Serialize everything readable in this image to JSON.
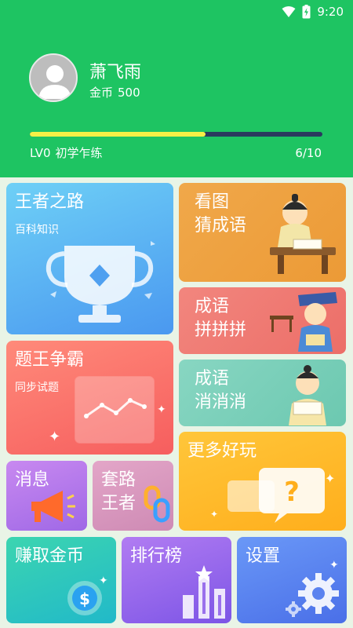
{
  "status_bar": {
    "time": "9:20",
    "icons": [
      "wifi-icon",
      "battery-charging-icon"
    ]
  },
  "profile": {
    "name": "萧飞雨",
    "coins_label": "金币",
    "coins_value": "500",
    "level": "LV0",
    "level_title": "初学乍练",
    "progress_text": "6/10",
    "progress_fraction": 0.6
  },
  "cards": {
    "wangzhe": {
      "title": "王者之路",
      "subtitle": "百科知识"
    },
    "kantu": {
      "title_line1": "看图",
      "title_line2": "猜成语"
    },
    "pinpin": {
      "title_line1": "成语",
      "title_line2": "拼拼拼"
    },
    "xiaoxiao": {
      "title_line1": "成语",
      "title_line2": "消消消"
    },
    "tiwang": {
      "title": "题王争霸",
      "subtitle": "同步试题"
    },
    "more": {
      "title": "更多好玩"
    },
    "message": {
      "title": "消息"
    },
    "taolu": {
      "title_line1": "套路",
      "title_line2": "王者"
    },
    "earn": {
      "title": "赚取金币"
    },
    "rank": {
      "title": "排行榜"
    },
    "settings": {
      "title": "设置"
    }
  },
  "colors": {
    "header_green": "#1ec462",
    "progress_yellow": "#f6f046",
    "progress_track": "#2a3a5e"
  }
}
